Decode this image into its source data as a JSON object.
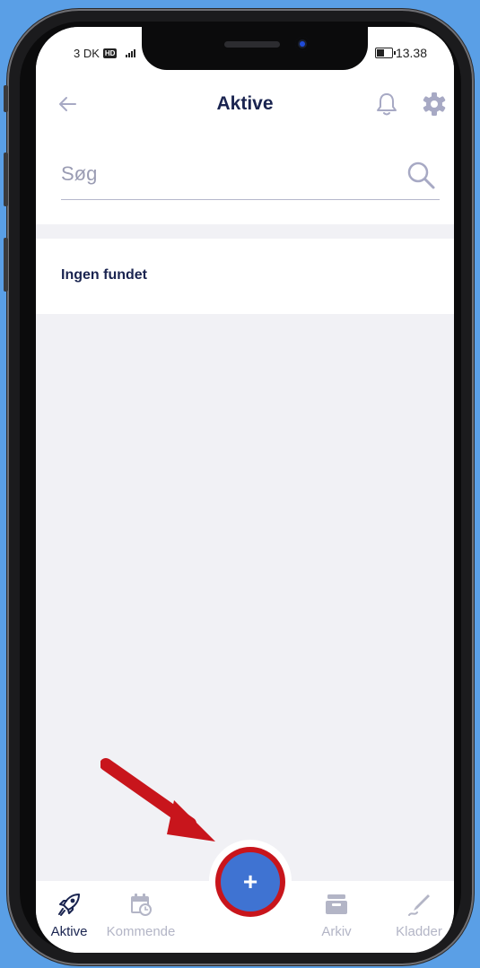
{
  "status_bar": {
    "carrier": "3 DK",
    "network_badge": "HD",
    "time": "13.38"
  },
  "app_bar": {
    "title": "Aktive",
    "back_icon": "arrow-left-icon",
    "bell_icon": "bell-icon",
    "settings_icon": "gear-icon"
  },
  "search": {
    "placeholder": "Søg",
    "icon": "search-icon"
  },
  "results": {
    "empty_message": "Ingen fundet"
  },
  "fab": {
    "label": "+",
    "highlight_color": "#c8151c",
    "fill_color": "#3f73d2"
  },
  "tabs": [
    {
      "label": "Aktive",
      "icon": "rocket-icon",
      "active": true
    },
    {
      "label": "Kommende",
      "icon": "calendar-clock-icon",
      "active": false
    },
    {
      "label": "Arkiv",
      "icon": "archive-box-icon",
      "active": false
    },
    {
      "label": "Kladder",
      "icon": "pen-icon",
      "active": false
    }
  ],
  "colors": {
    "primary_text": "#1a2450",
    "inactive": "#b3b5c6",
    "background": "#5a9fe6",
    "annotation_arrow": "#c8151c"
  }
}
